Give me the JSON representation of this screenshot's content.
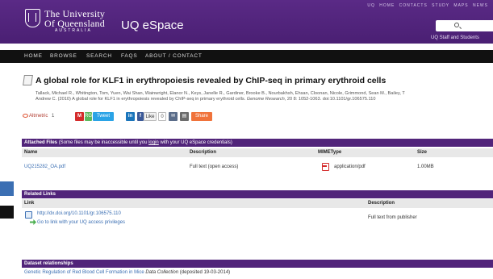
{
  "header": {
    "uni_line1": "The University",
    "uni_line2": "Of Queensland",
    "uni_line3": "AUSTRALIA",
    "app_title": "UQ eSpace",
    "top_links": "UQ HOME  CONTACTS  STUDY  MAPS  NEWS",
    "search_placeholder": "",
    "staff_link": "UQ Staff and Students"
  },
  "nav": {
    "items": [
      "HOME",
      "BROWSE",
      "SEARCH",
      "FAQS",
      "ABOUT / CONTACT"
    ]
  },
  "record": {
    "title": "A global role for KLF1 in erythropoiesis revealed by ChIP-seq in primary erythroid cells",
    "citation_line1": "Tallack, Michael R., Whitington, Tom, Yuen, Wai Shan, Wainwright, Elanor N., Keys, Janelle R., Gardiner, Brooke B., Nourbakhsh, Ehsan, Cloonan, Nicole, Grimmond, Sean M., Bailey, T",
    "citation_line2_prefix": "Andrew C. (2010) A global role for KLF1 in erythropoiesis revealed by ChIP-seq in primary erythroid cells.",
    "citation_journal": "Genome Research",
    "citation_line2_suffix": ", 20 8: 1052-1063. doi:10.1101/gr.106575.110"
  },
  "share": {
    "altmetric_label": "Altmetric",
    "altmetric_count": "1",
    "mendeley": "M",
    "researchgate": "RG",
    "tweet": "Tweet",
    "linkedin": "in",
    "facebook": "f",
    "like": "Like",
    "like_count": "0",
    "share": "Share"
  },
  "attached_files": {
    "section_title": "Attached Files",
    "note_prefix": "(Some files may be inaccessible until you",
    "note_link": "login",
    "note_suffix": "with your UQ eSpace credentials)",
    "columns": [
      "Name",
      "Description",
      "MIMEType",
      "Size"
    ],
    "rows": [
      {
        "name": "UQ215282_OA.pdf",
        "description": "Full text (open access)",
        "mime": "application/pdf",
        "size": "1.00MB"
      }
    ]
  },
  "related_links": {
    "section_title": "Related Links",
    "columns": [
      "Link",
      "Description"
    ],
    "rows": [
      {
        "link": "http://dx.doi.org/10.1101/gr.106575.110",
        "access_note": "Go to link with your UQ access privileges",
        "description": "Full text from publisher"
      }
    ]
  },
  "dataset_relationships": {
    "section_title": "Dataset relationships",
    "entry_link": "Genetic Regulation of Red Blood Cell Formation in Mice",
    "entry_type": "Data Collection",
    "entry_suffix": "(deposited 19-03-2014)"
  },
  "colors": {
    "brand_purple": "#51247a",
    "link_blue": "#3b6fb3",
    "nav_black": "#111111"
  }
}
